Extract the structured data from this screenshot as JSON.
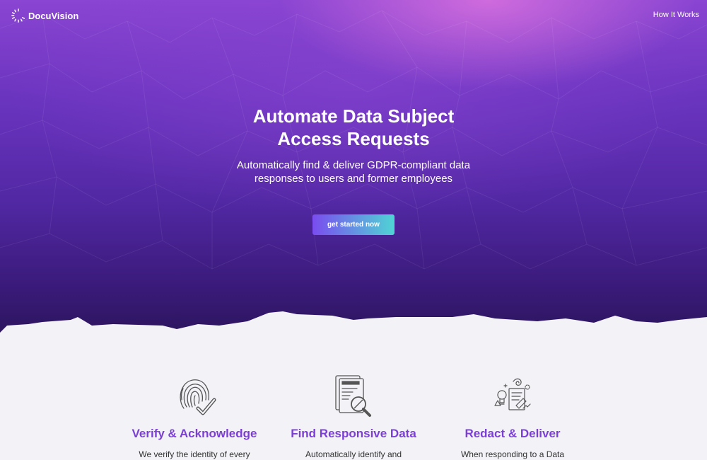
{
  "brand": {
    "name": "DocuVision"
  },
  "nav": {
    "how_it_works": "How It Works"
  },
  "hero": {
    "title_line1": "Automate Data Subject",
    "title_line2": "Access Requests",
    "subtitle_line1": "Automatically find & deliver GDPR-compliant data",
    "subtitle_line2": "responses to users and former employees",
    "cta_label": "get started now"
  },
  "features": [
    {
      "icon": "fingerprint-check-icon",
      "title": "Verify & Acknowledge",
      "text": "We verify the identity of every"
    },
    {
      "icon": "document-search-icon",
      "title": "Find Responsive Data",
      "text": "Automatically identify and"
    },
    {
      "icon": "redact-deliver-icon",
      "title": "Redact & Deliver",
      "text": "When responding to a Data"
    }
  ],
  "colors": {
    "hero_top": "#8a45d2",
    "hero_bottom": "#2d155f",
    "accent": "#7b3fd6",
    "cta_start": "#7a4cf0",
    "cta_end": "#4fd4d4",
    "page_background": "#f3f2f7"
  }
}
